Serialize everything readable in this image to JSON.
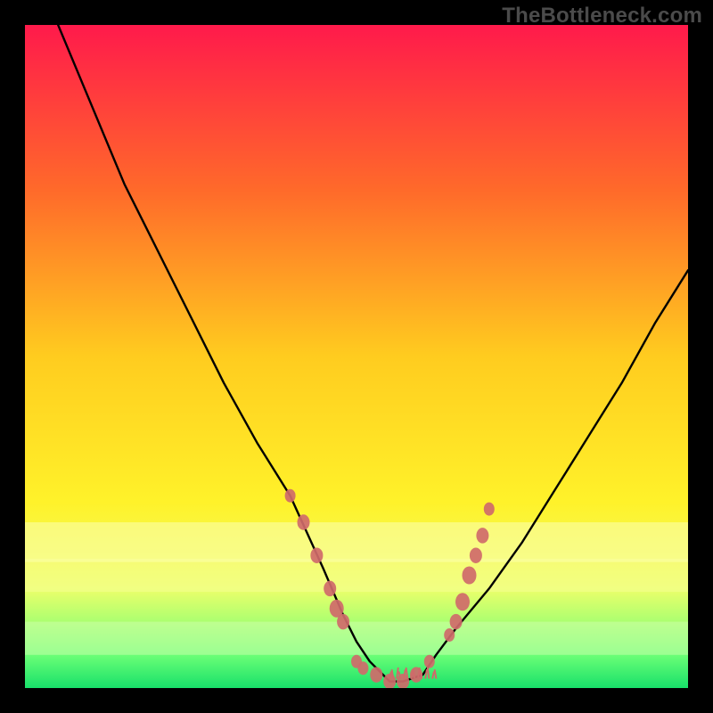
{
  "watermark": "TheBottleneck.com",
  "chart_data": {
    "type": "line",
    "title": "",
    "xlabel": "",
    "ylabel": "",
    "xlim": [
      0,
      100
    ],
    "ylim": [
      0,
      100
    ],
    "gradient_stops": [
      {
        "offset": 0,
        "color": "#ff1a4b"
      },
      {
        "offset": 25,
        "color": "#ff6a2a"
      },
      {
        "offset": 50,
        "color": "#ffcc1f"
      },
      {
        "offset": 72,
        "color": "#fff22a"
      },
      {
        "offset": 85,
        "color": "#ecff6a"
      },
      {
        "offset": 95,
        "color": "#6bff76"
      },
      {
        "offset": 100,
        "color": "#18e06a"
      }
    ],
    "bottom_band": {
      "top_pct": 75,
      "cream": "#fcffb0",
      "pale": "#d8ffb5"
    },
    "series": [
      {
        "name": "curve",
        "x": [
          5,
          10,
          15,
          20,
          25,
          30,
          35,
          40,
          45,
          48,
          50,
          52,
          54,
          55,
          57,
          60,
          62,
          65,
          70,
          75,
          80,
          85,
          90,
          95,
          100
        ],
        "y": [
          100,
          88,
          76,
          66,
          56,
          46,
          37,
          29,
          18,
          11,
          7,
          4,
          2,
          1,
          1,
          2,
          5,
          9,
          15,
          22,
          30,
          38,
          46,
          55,
          63
        ]
      }
    ],
    "marker_groups": [
      {
        "name": "left-cluster",
        "color": "#cf6a6a",
        "points": [
          {
            "x": 40,
            "y": 29,
            "r": 6
          },
          {
            "x": 42,
            "y": 25,
            "r": 7
          },
          {
            "x": 44,
            "y": 20,
            "r": 7
          },
          {
            "x": 46,
            "y": 15,
            "r": 7
          },
          {
            "x": 47,
            "y": 12,
            "r": 8
          },
          {
            "x": 48,
            "y": 10,
            "r": 7
          }
        ]
      },
      {
        "name": "trough-cluster",
        "color": "#cf6a6a",
        "points": [
          {
            "x": 50,
            "y": 4,
            "r": 6
          },
          {
            "x": 51,
            "y": 3,
            "r": 6
          },
          {
            "x": 53,
            "y": 2,
            "r": 7
          },
          {
            "x": 55,
            "y": 1,
            "r": 7
          },
          {
            "x": 57,
            "y": 1,
            "r": 7
          },
          {
            "x": 59,
            "y": 2,
            "r": 7
          },
          {
            "x": 61,
            "y": 4,
            "r": 6
          }
        ]
      },
      {
        "name": "right-cluster",
        "color": "#cf6a6a",
        "points": [
          {
            "x": 64,
            "y": 8,
            "r": 6
          },
          {
            "x": 65,
            "y": 10,
            "r": 7
          },
          {
            "x": 66,
            "y": 13,
            "r": 8
          },
          {
            "x": 67,
            "y": 17,
            "r": 8
          },
          {
            "x": 68,
            "y": 20,
            "r": 7
          },
          {
            "x": 69,
            "y": 23,
            "r": 7
          },
          {
            "x": 70,
            "y": 27,
            "r": 6
          }
        ]
      }
    ],
    "grass_fringe": {
      "y": 1.5,
      "x_start": 55,
      "x_end": 62,
      "count": 14,
      "height": 3,
      "color": "#cf6a6a"
    }
  }
}
